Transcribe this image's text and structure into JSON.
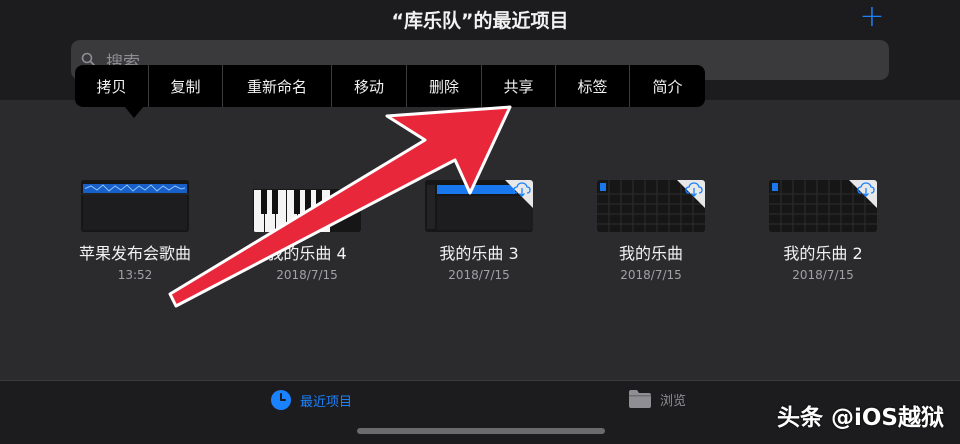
{
  "header": {
    "title": "“库乐队”的最近项目",
    "add_label": "+"
  },
  "search": {
    "placeholder": "搜索"
  },
  "context_menu": {
    "items": [
      {
        "label": "拷贝"
      },
      {
        "label": "复制"
      },
      {
        "label": "重新命名"
      },
      {
        "label": "移动"
      },
      {
        "label": "删除"
      },
      {
        "label": "共享"
      },
      {
        "label": "标签"
      },
      {
        "label": "简介"
      }
    ]
  },
  "files": [
    {
      "name": "苹果发布会歌曲",
      "date": "13:52",
      "thumb": "waveform"
    },
    {
      "name": "我的乐曲 4",
      "date": "2018/7/15",
      "thumb": "keyboard"
    },
    {
      "name": "我的乐曲 3",
      "date": "2018/7/15",
      "thumb": "tracks-cloud"
    },
    {
      "name": "我的乐曲",
      "date": "2018/7/15",
      "thumb": "grid-cloud"
    },
    {
      "name": "我的乐曲 2",
      "date": "2018/7/15",
      "thumb": "grid-cloud"
    }
  ],
  "tabbar": {
    "recent": {
      "label": "最近项目",
      "icon": "clock-icon"
    },
    "browse": {
      "label": "浏览",
      "icon": "folder-icon"
    }
  },
  "watermark": {
    "text": "头条 @iOS越狱"
  },
  "colors": {
    "accent": "#1a82ff",
    "annotation_arrow": "#e8283a",
    "background": "#2b2b2d",
    "bar": "#1c1c1e"
  }
}
